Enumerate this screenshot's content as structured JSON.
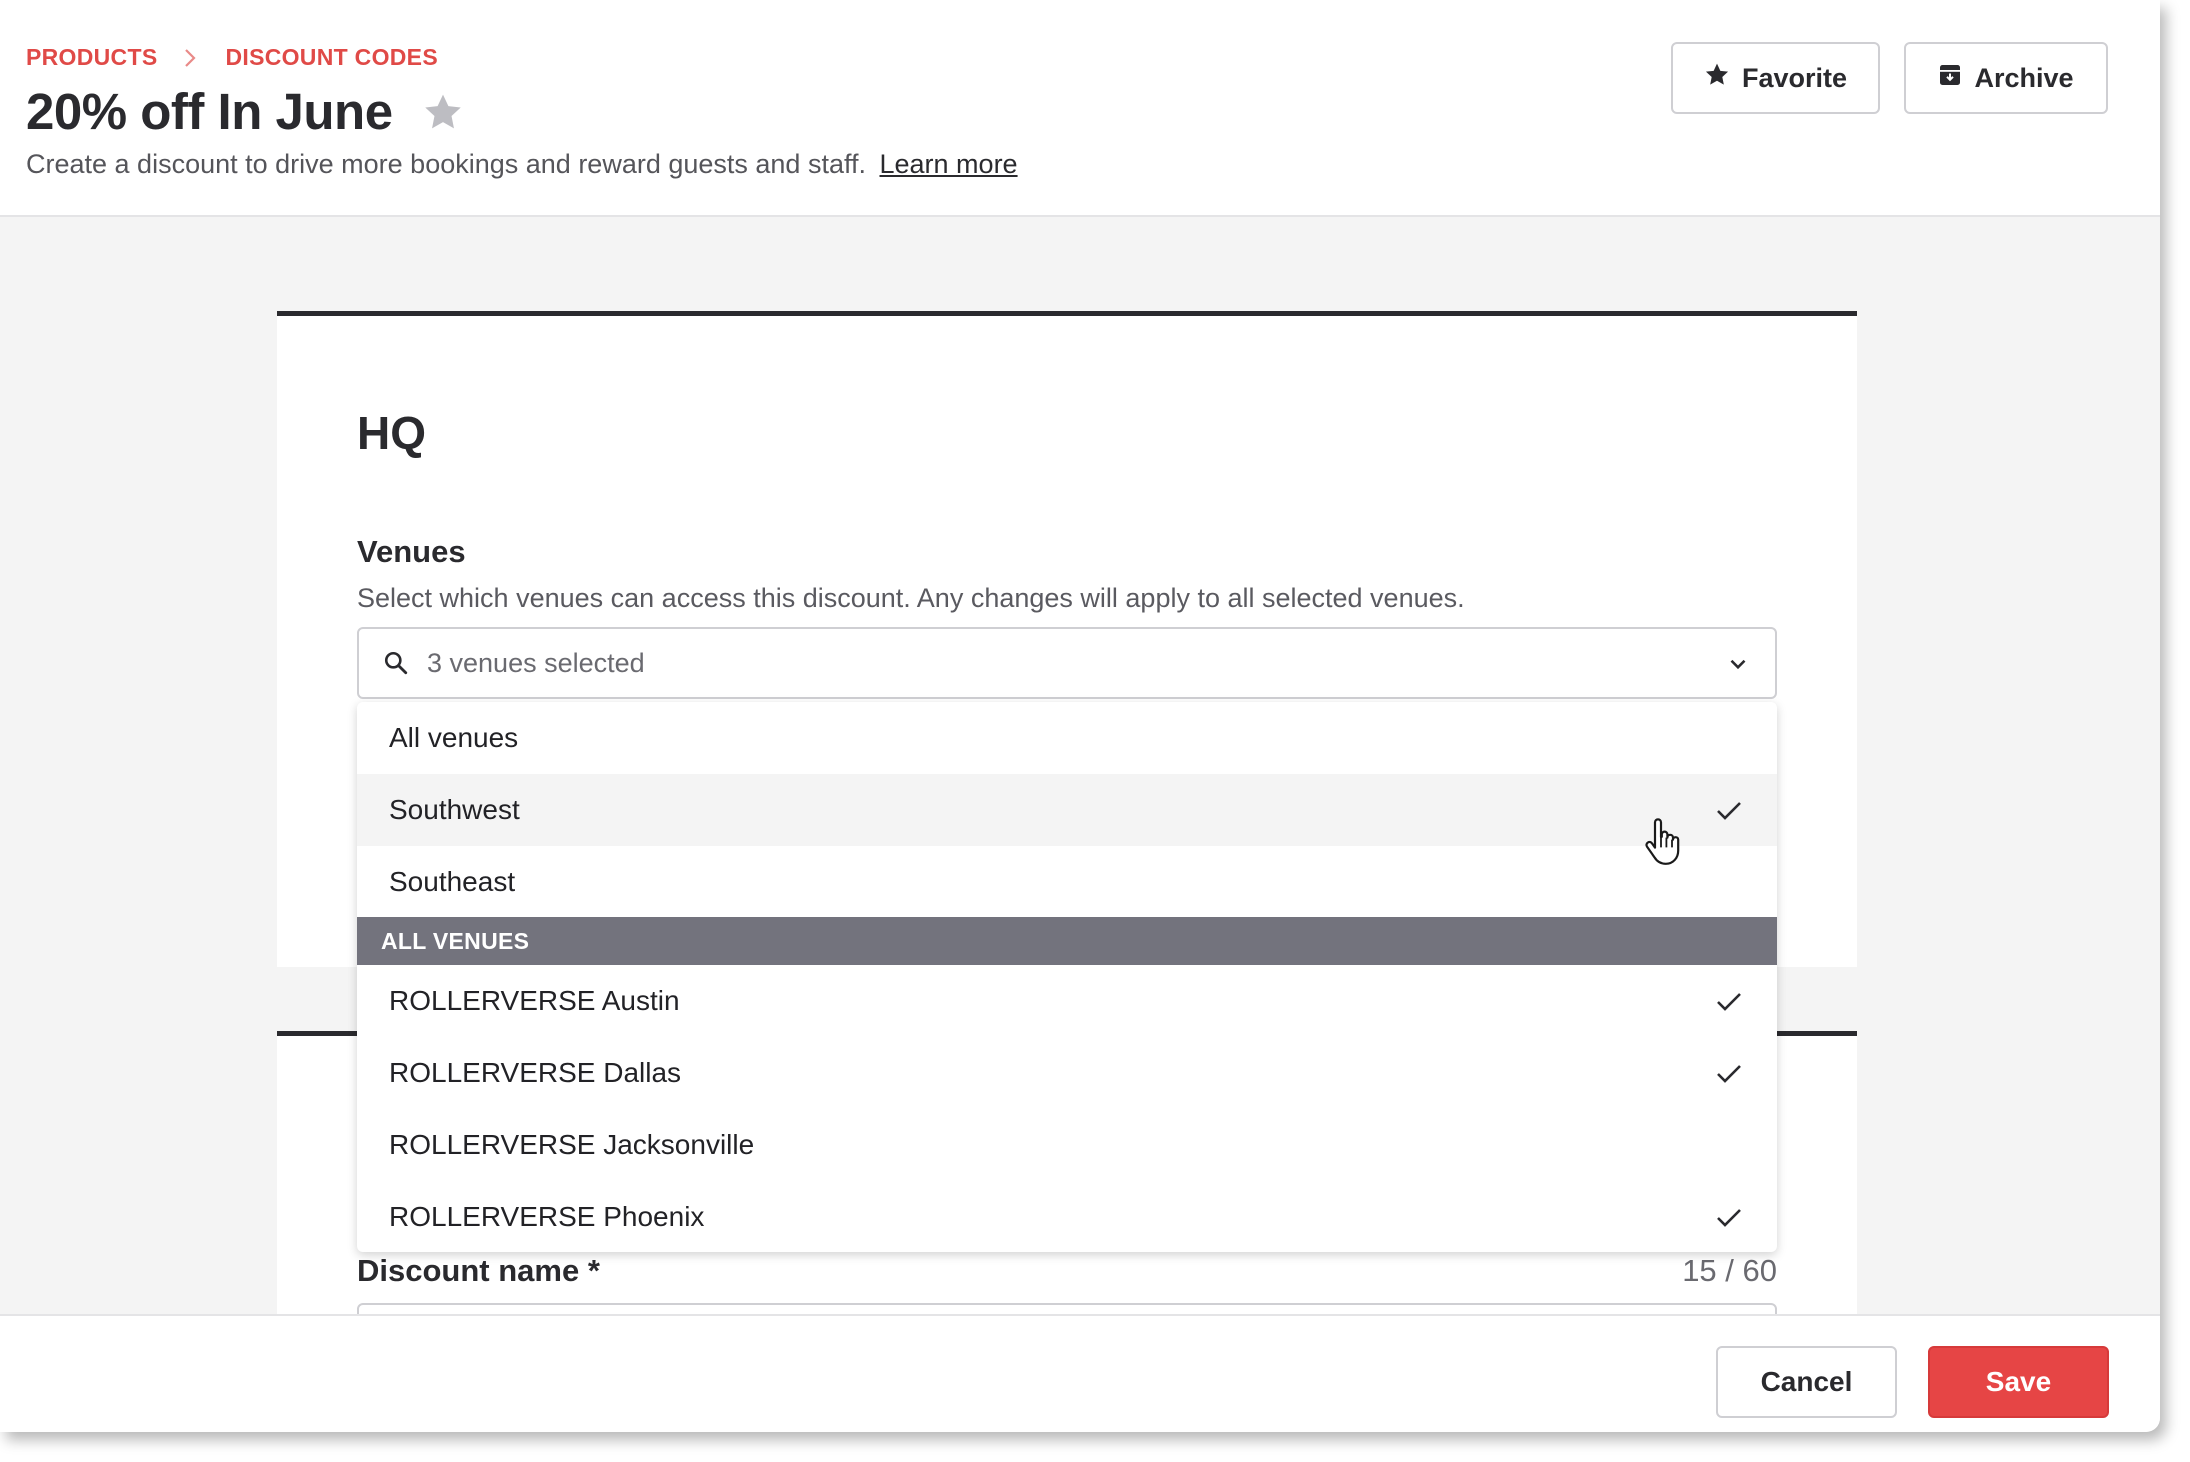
{
  "breadcrumb": {
    "root": "PRODUCTS",
    "current": "DISCOUNT CODES"
  },
  "page": {
    "title": "20% off In June",
    "subtitle": "Create a discount to drive more bookings and reward guests and staff.",
    "learn_more": "Learn more"
  },
  "header_actions": {
    "favorite": "Favorite",
    "archive": "Archive"
  },
  "card": {
    "title": "HQ",
    "venues_label": "Venues",
    "venues_help": "Select which venues can access this discount. Any changes will apply to all selected venues.",
    "select_value": "3 venues selected"
  },
  "dropdown": {
    "options": [
      {
        "label": "All venues",
        "checked": false
      },
      {
        "label": "Southwest",
        "checked": true
      },
      {
        "label": "Southeast",
        "checked": false
      }
    ],
    "group_header": "ALL VENUES",
    "venues": [
      {
        "label": "ROLLERVERSE Austin",
        "checked": true
      },
      {
        "label": "ROLLERVERSE Dallas",
        "checked": true
      },
      {
        "label": "ROLLERVERSE Jacksonville",
        "checked": false
      },
      {
        "label": "ROLLERVERSE Phoenix",
        "checked": true
      }
    ]
  },
  "discount_name": {
    "label": "Discount name *",
    "count": "15 / 60"
  },
  "footer": {
    "cancel": "Cancel",
    "save": "Save"
  },
  "colors": {
    "accent": "#e04a47",
    "save": "#e64545",
    "group_header": "#73737d"
  },
  "icons": [
    "chevron-right-icon",
    "star-icon",
    "archive-icon",
    "search-icon",
    "chevron-down-icon",
    "check-icon",
    "hand-cursor-icon"
  ]
}
